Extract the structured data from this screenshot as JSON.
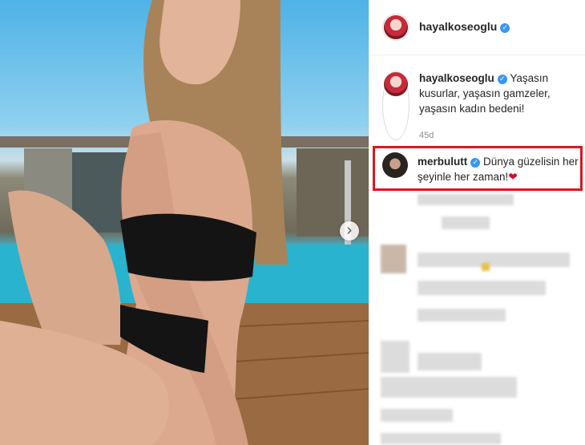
{
  "header": {
    "username": "hayalkoseoglu",
    "verified_icon": "verified-badge-icon"
  },
  "caption": {
    "username": "hayalkoseoglu",
    "text": "Yaşasın kusurlar, yaşasın gamzeler, yaşasın kadın bedeni!",
    "timestamp": "45d"
  },
  "highlighted_comment": {
    "username": "merbulutt",
    "text": "Dünya güzelisin her şeyinle her zaman!",
    "emoji": "❤",
    "highlight_color": "#e0141f"
  },
  "carousel": {
    "next_icon": "›"
  },
  "colors": {
    "verified": "#3897f0",
    "text": "#262626",
    "muted": "#8e8e8e"
  }
}
